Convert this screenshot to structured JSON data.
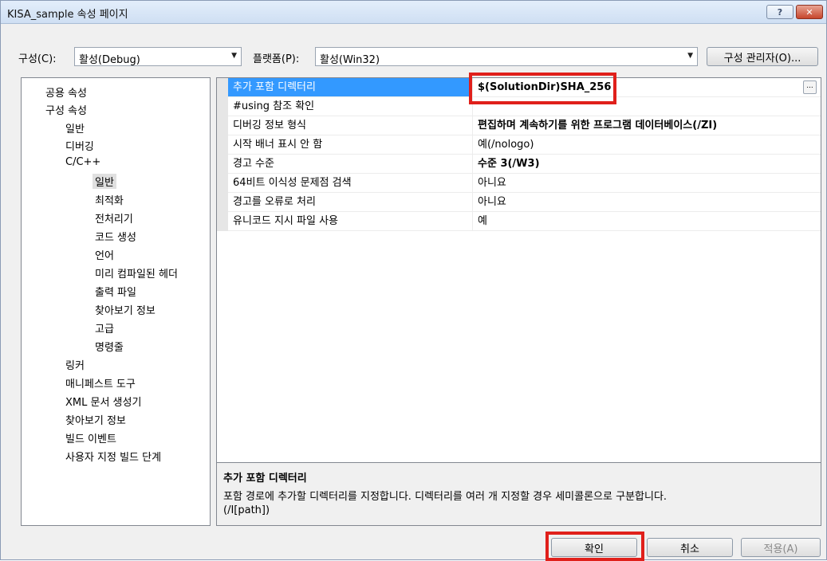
{
  "window": {
    "title": "KISA_sample 속성 페이지"
  },
  "titlebar": {
    "help_glyph": "?",
    "close_glyph": "✕"
  },
  "toolbar": {
    "config_label": "구성(C):",
    "config_value": "활성(Debug)",
    "platform_label": "플랫폼(P):",
    "platform_value": "활성(Win32)",
    "config_manager_button": "구성 관리자(O)..."
  },
  "tree": {
    "items": [
      {
        "label": "공용 속성"
      },
      {
        "label": "구성 속성"
      },
      {
        "label": "일반"
      },
      {
        "label": "디버깅"
      },
      {
        "label": "C/C++"
      },
      {
        "label": "일반"
      },
      {
        "label": "최적화"
      },
      {
        "label": "전처리기"
      },
      {
        "label": "코드 생성"
      },
      {
        "label": "언어"
      },
      {
        "label": "미리 컴파일된 헤더"
      },
      {
        "label": "출력 파일"
      },
      {
        "label": "찾아보기 정보"
      },
      {
        "label": "고급"
      },
      {
        "label": "명령줄"
      },
      {
        "label": "링커"
      },
      {
        "label": "매니페스트 도구"
      },
      {
        "label": "XML 문서 생성기"
      },
      {
        "label": "찾아보기 정보"
      },
      {
        "label": "빌드 이벤트"
      },
      {
        "label": "사용자 지정 빌드 단계"
      }
    ]
  },
  "grid": {
    "rows": [
      {
        "name": "추가 포함 디렉터리",
        "value": "$(SolutionDir)SHA_256"
      },
      {
        "name": "#using 참조 확인",
        "value": ""
      },
      {
        "name": "디버깅 정보 형식",
        "value": "편집하며 계속하기를 위한 프로그램 데이터베이스(/ZI)"
      },
      {
        "name": "시작 배너 표시 안 함",
        "value": "예(/nologo)"
      },
      {
        "name": "경고 수준",
        "value": "수준 3(/W3)"
      },
      {
        "name": "64비트 이식성 문제점 검색",
        "value": "아니요"
      },
      {
        "name": "경고를 오류로 처리",
        "value": "아니요"
      },
      {
        "name": "유니코드 지시 파일 사용",
        "value": "예"
      }
    ],
    "ellipsis_label": "..."
  },
  "description": {
    "title": "추가 포함 디렉터리",
    "text": "포함 경로에 추가할 디렉터리를 지정합니다. 디렉터리를 여러 개 지정할 경우 세미콜론으로 구분합니다.",
    "switch": "(/I[path])"
  },
  "footer": {
    "ok_button": "확인",
    "cancel_button": "취소",
    "apply_button": "적용(A)"
  },
  "colors": {
    "selection": "#3399ff",
    "highlight_box": "#e0201b"
  }
}
